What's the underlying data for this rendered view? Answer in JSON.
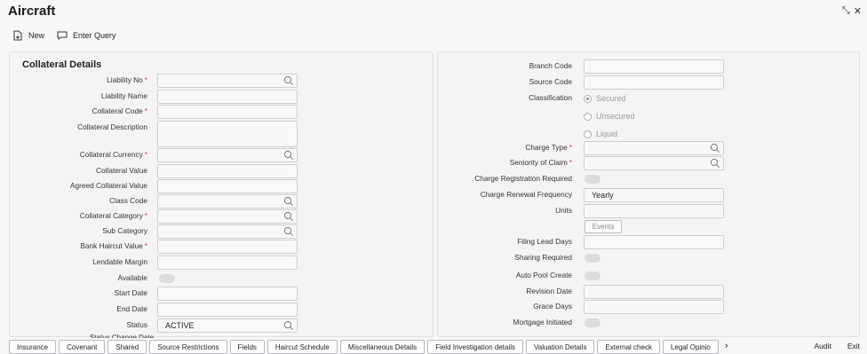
{
  "window": {
    "title": "Aircraft"
  },
  "toolbar": {
    "new_label": "New",
    "enter_query_label": "Enter Query"
  },
  "left_panel": {
    "title": "Collateral Details",
    "rows": [
      {
        "label": "Liability No",
        "required": true,
        "type": "lov",
        "value": ""
      },
      {
        "label": "Liability Name",
        "required": false,
        "type": "text",
        "value": ""
      },
      {
        "label": "Collateral Code",
        "required": true,
        "type": "text",
        "value": ""
      },
      {
        "label": "Collateral Description",
        "required": false,
        "type": "textarea",
        "value": ""
      },
      {
        "label": "Collateral Currency",
        "required": true,
        "type": "lov",
        "value": ""
      },
      {
        "label": "Collateral Value",
        "required": false,
        "type": "text",
        "value": ""
      },
      {
        "label": "Agreed Collateral Value",
        "required": false,
        "type": "text",
        "value": ""
      },
      {
        "label": "Class Code",
        "required": false,
        "type": "lov",
        "value": ""
      },
      {
        "label": "Collateral Category",
        "required": true,
        "type": "lov",
        "value": ""
      },
      {
        "label": "Sub Category",
        "required": false,
        "type": "lov",
        "value": ""
      },
      {
        "label": "Bank Haircut Value",
        "required": true,
        "type": "text",
        "value": ""
      },
      {
        "label": "Lendable Margin",
        "required": false,
        "type": "text",
        "value": ""
      },
      {
        "label": "Available",
        "required": false,
        "type": "toggle",
        "value": ""
      },
      {
        "label": "Start Date",
        "required": false,
        "type": "text",
        "value": ""
      },
      {
        "label": "End Date",
        "required": false,
        "type": "text",
        "value": ""
      },
      {
        "label": "Status",
        "required": false,
        "type": "lov",
        "value": "ACTIVE"
      }
    ],
    "truncated_label": "Status Change Date"
  },
  "right_panel": {
    "branch_code": {
      "label": "Branch Code",
      "value": ""
    },
    "source_code": {
      "label": "Source Code",
      "value": ""
    },
    "classification": {
      "label": "Classification",
      "options": [
        "Secured",
        "Unsecured",
        "Liquid"
      ],
      "selected": "Secured"
    },
    "charge_type": {
      "label": "Charge Type",
      "value": ""
    },
    "seniority_of_claim": {
      "label": "Seniority of Claim",
      "value": ""
    },
    "charge_registration_required": {
      "label": "Charge Registration Required"
    },
    "charge_renewal_frequency": {
      "label": "Charge Renewal Frequency",
      "value": "Yearly"
    },
    "units": {
      "label": "Units",
      "value": ""
    },
    "events_button": "Events",
    "filing_lead_days": {
      "label": "Filing Lead Days",
      "value": ""
    },
    "sharing_required": {
      "label": "Sharing Required"
    },
    "auto_pool_create": {
      "label": "Auto Pool Create"
    },
    "revision_date": {
      "label": "Revision Date",
      "value": ""
    },
    "grace_days": {
      "label": "Grace Days",
      "value": ""
    },
    "mortgage_initiated": {
      "label": "Mortgage Initiated"
    }
  },
  "tabs": [
    "Insurance",
    "Covenant",
    "Shared",
    "Source Restrictions",
    "Fields",
    "Haircut Schedule",
    "Miscellaneous Details",
    "Field Investigation details",
    "Valuation Details",
    "External check",
    "Legal Opinio"
  ],
  "footer": {
    "audit_label": "Audit",
    "exit_label": "Exit"
  },
  "required_mark": "*",
  "colors": {
    "required": "#d1353a",
    "background": "#f7f7f8"
  }
}
